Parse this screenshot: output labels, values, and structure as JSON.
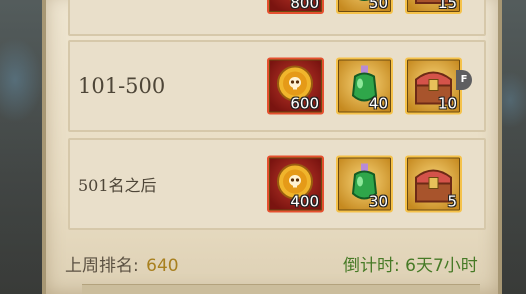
{
  "top_row": {
    "rewards": [
      {
        "icon": "gold-skull-coin-icon",
        "count": "800"
      },
      {
        "icon": "green-potion-icon",
        "count": "50"
      },
      {
        "icon": "treasure-chest-icon",
        "count": "15"
      }
    ]
  },
  "rank_rows": [
    {
      "label": "101-500",
      "rewards": [
        {
          "icon": "gold-skull-coin-icon",
          "count": "600"
        },
        {
          "icon": "green-potion-icon",
          "count": "40"
        },
        {
          "icon": "treasure-chest-icon",
          "count": "10"
        }
      ]
    },
    {
      "label": "501名之后",
      "rewards": [
        {
          "icon": "gold-skull-coin-icon",
          "count": "400"
        },
        {
          "icon": "green-potion-icon",
          "count": "30"
        },
        {
          "icon": "treasure-chest-icon",
          "count": "5"
        }
      ]
    }
  ],
  "side_badge": "F",
  "footer": {
    "last_week_rank_label": "上周排名:",
    "last_week_rank_value": "640",
    "countdown": "倒计时: 6天7小时"
  },
  "colors": {
    "coin_slot": "#a3231a",
    "gold_slot": "#e0a73a",
    "countdown_text": "#467a26",
    "rank_value": "#a8801f"
  }
}
